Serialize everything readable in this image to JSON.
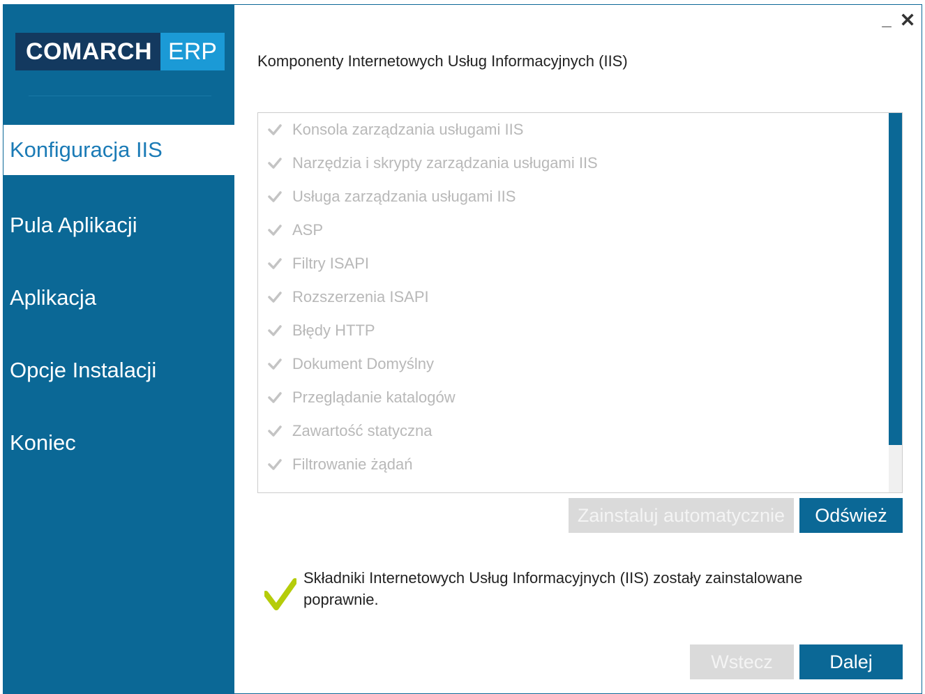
{
  "window": {
    "minimize_label": "_",
    "close_label": "✕"
  },
  "brand": {
    "name": "COMARCH",
    "product": "ERP",
    "colors": {
      "navy": "#13395f",
      "blue": "#1b9ad6",
      "sidebar": "#0b6896"
    }
  },
  "sidebar": {
    "items": [
      {
        "label": "Konfiguracja IIS",
        "active": true
      },
      {
        "label": "Pula Aplikacji",
        "active": false
      },
      {
        "label": "Aplikacja",
        "active": false
      },
      {
        "label": "Opcje Instalacji",
        "active": false
      },
      {
        "label": "Koniec",
        "active": false
      }
    ]
  },
  "main": {
    "title": "Komponenty Internetowych Usług Informacyjnych (IIS)",
    "components": [
      {
        "label": "Konsola zarządzania usługami IIS",
        "icon": "check-icon"
      },
      {
        "label": "Narzędzia i skrypty zarządzania usługami IIS",
        "icon": "check-icon"
      },
      {
        "label": "Usługa zarządzania usługami IIS",
        "icon": "check-icon"
      },
      {
        "label": "ASP",
        "icon": "check-icon"
      },
      {
        "label": "Filtry ISAPI",
        "icon": "check-icon"
      },
      {
        "label": "Rozszerzenia ISAPI",
        "icon": "check-icon"
      },
      {
        "label": "Błędy HTTP",
        "icon": "check-icon"
      },
      {
        "label": "Dokument Domyślny",
        "icon": "check-icon"
      },
      {
        "label": "Przeglądanie katalogów",
        "icon": "check-icon"
      },
      {
        "label": "Zawartość statyczna",
        "icon": "check-icon"
      },
      {
        "label": "Filtrowanie żądań",
        "icon": "check-icon"
      }
    ],
    "install_auto_label": "Zainstaluj automatycznie",
    "refresh_label": "Odśwież",
    "status_text": "Składniki Internetowych Usług Informacyjnych (IIS) zostały zainstalowane poprawnie.",
    "status_icon": "success-check-icon",
    "status_color": "#b5cc0a"
  },
  "footer": {
    "back_label": "Wstecz",
    "next_label": "Dalej"
  }
}
